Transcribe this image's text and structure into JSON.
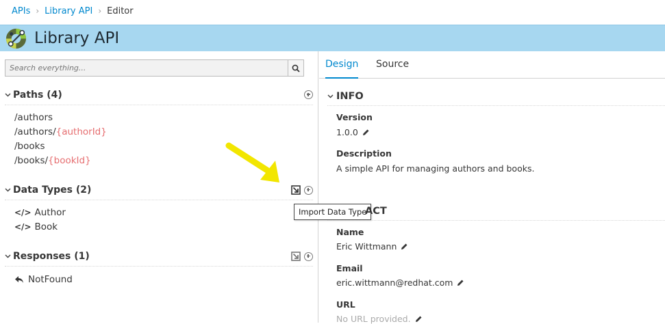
{
  "breadcrumb": {
    "items": [
      "APIs",
      "Library API"
    ],
    "current": "Editor"
  },
  "header": {
    "title": "Library API"
  },
  "search": {
    "placeholder": "Search everything..."
  },
  "paths": {
    "heading": "Paths (4)",
    "items": [
      {
        "base": "/authors",
        "param": ""
      },
      {
        "base": "/authors/",
        "param": "{authorId}"
      },
      {
        "base": "/books",
        "param": ""
      },
      {
        "base": "/books/",
        "param": "{bookId}"
      }
    ]
  },
  "data_types": {
    "heading": "Data Types (2)",
    "items": [
      "Author",
      "Book"
    ]
  },
  "responses": {
    "heading": "Responses (1)",
    "items": [
      "NotFound"
    ]
  },
  "tooltip": {
    "text": "Import Data Type"
  },
  "tabs": {
    "design": "Design",
    "source": "Source"
  },
  "info": {
    "heading": "INFO",
    "version_label": "Version",
    "version_value": "1.0.0",
    "description_label": "Description",
    "description_value": "A simple API for managing authors and books."
  },
  "contact": {
    "heading_partial": "ACT",
    "name_label": "Name",
    "name_value": "Eric Wittmann",
    "email_label": "Email",
    "email_value": "eric.wittmann@redhat.com",
    "url_label": "URL",
    "url_value": "No URL provided."
  },
  "colors": {
    "accent": "#0088ce",
    "header_bg": "#a7d7f0",
    "param": "#e66e70",
    "annotation_arrow": "#f2e600"
  }
}
